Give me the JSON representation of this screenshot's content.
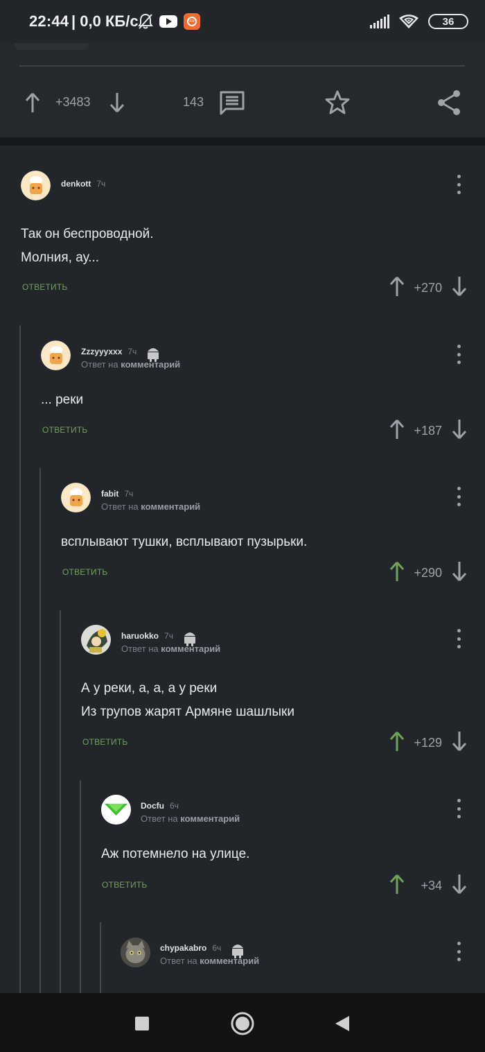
{
  "status_bar": {
    "time": "22:44",
    "speed": "| 0,0 КБ/с",
    "battery": "36"
  },
  "post_bar": {
    "rating": "+3483",
    "comments_count": "143"
  },
  "comments": [
    {
      "author": "denkott",
      "time": "7ч",
      "reply_prefix": "",
      "reply_target": "",
      "lines": [
        "Так он беспроводной.",
        "Молния, ау..."
      ],
      "answer": "ОТВЕТИТЬ",
      "score": "+270",
      "upvoted": false
    },
    {
      "author": "Zzzyyyxxx",
      "time": "7ч",
      "reply_prefix": "Ответ на",
      "reply_target": "комментарий",
      "lines": [
        "... реки"
      ],
      "answer": "ОТВЕТИТЬ",
      "score": "+187",
      "upvoted": false
    },
    {
      "author": "fabit",
      "time": "7ч",
      "reply_prefix": "Ответ на",
      "reply_target": "комментарий",
      "lines": [
        "всплывают тушки, всплывают пузырьки."
      ],
      "answer": "ОТВЕТИТЬ",
      "score": "+290",
      "upvoted": true
    },
    {
      "author": "haruokko",
      "time": "7ч",
      "reply_prefix": "Ответ на",
      "reply_target": "комментарий",
      "lines": [
        "А у реки, а, а, а у реки",
        "Из трупов жарят Армяне шашлыки"
      ],
      "answer": "ОТВЕТИТЬ",
      "score": "+129",
      "upvoted": true
    },
    {
      "author": "Docfu",
      "time": "6ч",
      "reply_prefix": "Ответ на",
      "reply_target": "комментарий",
      "lines": [
        "Аж потемнело на улице."
      ],
      "answer": "ОТВЕТИТЬ",
      "score": "+34",
      "upvoted": true
    },
    {
      "author": "chypakabro",
      "time": "6ч",
      "reply_prefix": "Ответ на",
      "reply_target": "комментарий",
      "lines": [],
      "answer": "",
      "score": "",
      "upvoted": false
    }
  ],
  "colors": {
    "background": "#22262b",
    "accent_green": "#6fa35a",
    "vote_grey": "#9ea3a8"
  }
}
